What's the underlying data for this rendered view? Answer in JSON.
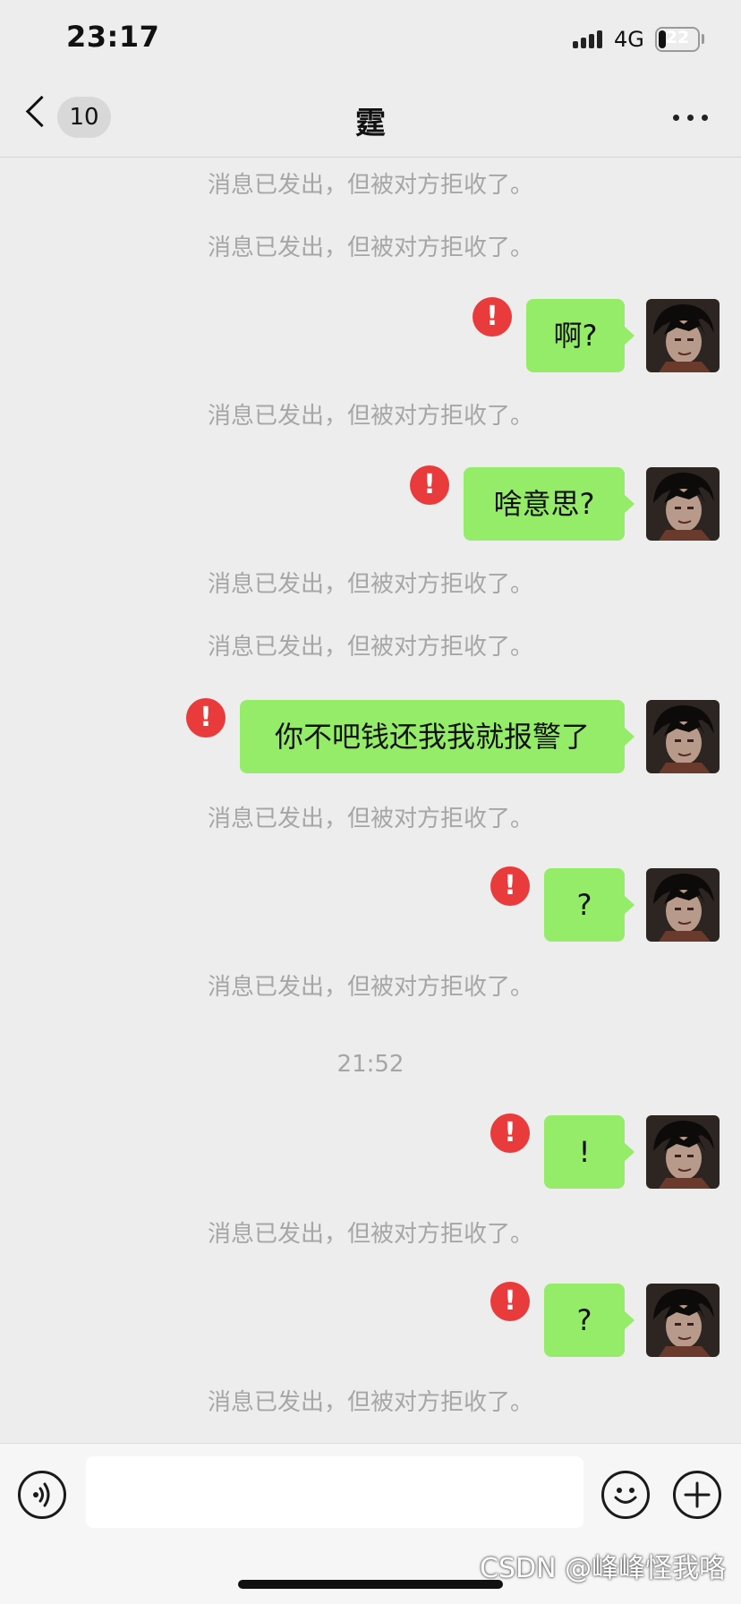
{
  "status_bar": {
    "time": "23:17",
    "network": "4G",
    "battery": "22"
  },
  "nav": {
    "unread_count": "10",
    "title": "霆",
    "more_icon": "ellipsis-icon",
    "back_icon": "chevron-left-icon"
  },
  "chat": {
    "timestamp": "21:52",
    "system_notices": [
      "消息已发出，但被对方拒收了。",
      "消息已发出，但被对方拒收了。",
      "消息已发出，但被对方拒收了。",
      "消息已发出，但被对方拒收了。",
      "消息已发出，但被对方拒收了。",
      "消息已发出，但被对方拒收了。",
      "消息已发出，但被对方拒收了。",
      "消息已发出，但被对方拒收了。",
      "消息已发出，但被对方拒收了。"
    ],
    "messages": [
      {
        "text": "啊?",
        "status": "failed"
      },
      {
        "text": "啥意思?",
        "status": "failed"
      },
      {
        "text": "你不吧钱还我我就报警了",
        "status": "failed"
      },
      {
        "text": "?",
        "status": "failed"
      },
      {
        "text": "!",
        "status": "failed"
      },
      {
        "text": "?",
        "status": "failed"
      }
    ],
    "error_mark": "!"
  },
  "input_bar": {
    "input_value": "",
    "voice_icon": "voice-icon",
    "emoji_icon": "emoji-icon",
    "plus_icon": "plus-icon"
  },
  "watermark": "CSDN @峰峰怪我咯",
  "colors": {
    "bubble": "#95ec69",
    "error": "#e93b3b",
    "background": "#ededed"
  }
}
